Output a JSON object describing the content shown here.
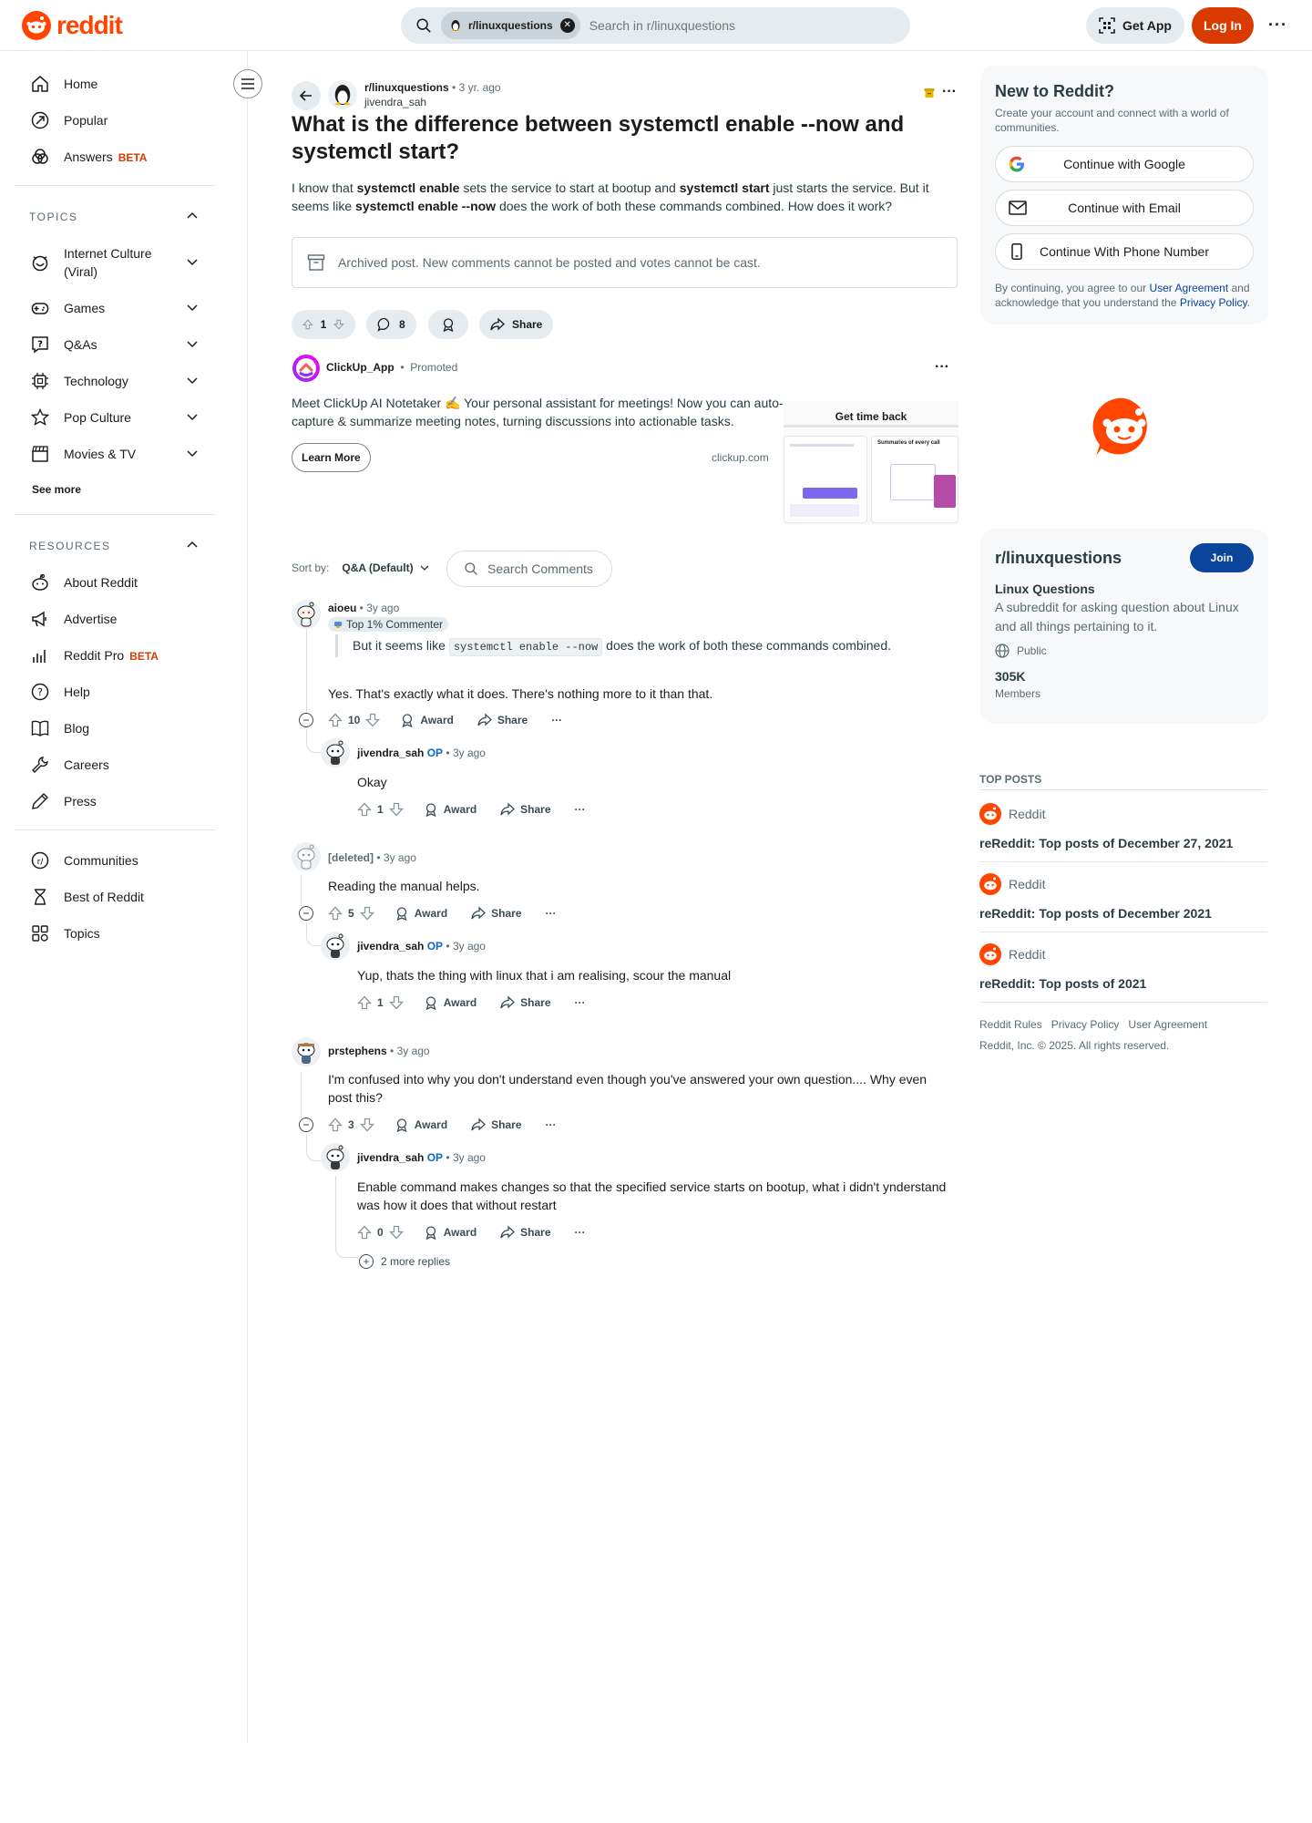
{
  "header": {
    "logo_text": "reddit",
    "search_chip": "r/linuxquestions",
    "search_placeholder": "Search in r/linuxquestions",
    "get_app": "Get App",
    "login": "Log In",
    "brand_color": "#ff4500"
  },
  "sidebar": {
    "main": [
      {
        "label": "Home",
        "icon": "home-icon"
      },
      {
        "label": "Popular",
        "icon": "popular-icon"
      },
      {
        "label": "Answers",
        "icon": "answers-icon",
        "badge": "BETA"
      }
    ],
    "topics_header": "TOPICS",
    "topics": [
      {
        "label": "Internet Culture (Viral)",
        "icon": "smiley-icon"
      },
      {
        "label": "Games",
        "icon": "gamepad-icon"
      },
      {
        "label": "Q&As",
        "icon": "question-icon"
      },
      {
        "label": "Technology",
        "icon": "chip-icon"
      },
      {
        "label": "Pop Culture",
        "icon": "star-icon"
      },
      {
        "label": "Movies & TV",
        "icon": "clapper-icon"
      }
    ],
    "see_more": "See more",
    "resources_header": "RESOURCES",
    "resources": [
      {
        "label": "About Reddit",
        "icon": "reddit-icon"
      },
      {
        "label": "Advertise",
        "icon": "megaphone-icon"
      },
      {
        "label": "Reddit Pro",
        "icon": "chart-icon",
        "badge": "BETA"
      },
      {
        "label": "Help",
        "icon": "help-icon"
      },
      {
        "label": "Blog",
        "icon": "book-icon"
      },
      {
        "label": "Careers",
        "icon": "wrench-icon"
      },
      {
        "label": "Press",
        "icon": "pen-icon"
      }
    ],
    "bottom": [
      {
        "label": "Communities",
        "icon": "communities-icon"
      },
      {
        "label": "Best of Reddit",
        "icon": "hourglass-icon"
      },
      {
        "label": "Topics",
        "icon": "topics-icon"
      }
    ]
  },
  "post": {
    "subreddit": "r/linuxquestions",
    "age": "3 yr. ago",
    "author": "jivendra_sah",
    "title": "What is the difference between systemctl enable --now and systemctl start?",
    "body_parts": [
      {
        "t": "I know that ",
        "b": false
      },
      {
        "t": "systemctl enable",
        "b": true
      },
      {
        "t": " sets the service to start at bootup and ",
        "b": false
      },
      {
        "t": "systemctl start",
        "b": true
      },
      {
        "t": " just starts the service. But it seems like ",
        "b": false
      },
      {
        "t": "systemctl enable --now",
        "b": true
      },
      {
        "t": " does the work of both these commands combined. How does it work?",
        "b": false
      }
    ],
    "archived_notice": "Archived post. New comments cannot be posted and votes cannot be cast.",
    "votes": "1",
    "comments": "8",
    "share": "Share"
  },
  "ad": {
    "advertiser": "ClickUp_App",
    "promoted": "Promoted",
    "body": "Meet ClickUp AI Notetaker ✍️ Your personal assistant for meetings! Now you can auto-capture & summarize meeting notes, turning discussions into actionable tasks.",
    "cta": "Learn More",
    "domain": "clickup.com",
    "image_title": "Get time back",
    "image_caption": "Summaries of every call"
  },
  "comments_bar": {
    "sort_label": "Sort by:",
    "sort_value": "Q&A (Default)",
    "search": "Search Comments"
  },
  "comments": [
    {
      "author": "aioeu",
      "age": "3y ago",
      "badge": "Top 1% Commenter",
      "quote_pre": "But it seems like ",
      "quote_code": "systemctl enable --now",
      "quote_post": " does the work of both these commands combined.",
      "text": "Yes. That's exactly what it does. There's nothing more to it than that.",
      "votes": "10",
      "reply": {
        "author": "jivendra_sah",
        "op": "OP",
        "age": "3y ago",
        "text": "Okay",
        "votes": "1"
      }
    },
    {
      "author": "[deleted]",
      "age": "3y ago",
      "text": "Reading the manual helps.",
      "votes": "5",
      "reply": {
        "author": "jivendra_sah",
        "op": "OP",
        "age": "3y ago",
        "text": "Yup, thats the thing with linux that i am realising, scour the manual",
        "votes": "1"
      }
    },
    {
      "author": "prstephens",
      "age": "3y ago",
      "text": "I'm confused into why you don't understand even though you've answered your own question.... Why even post this?",
      "votes": "3",
      "reply": {
        "author": "jivendra_sah",
        "op": "OP",
        "age": "3y ago",
        "text": "Enable command makes changes so that the specified service starts on bootup, what i didn't ynderstand was how it does that without restart",
        "votes": "0"
      },
      "more_replies": "2 more replies"
    }
  ],
  "actions": {
    "award": "Award",
    "share": "Share"
  },
  "right": {
    "new_title": "New to Reddit?",
    "new_desc": "Create your account and connect with a world of communities.",
    "google": "Continue with Google",
    "email": "Continue with Email",
    "phone": "Continue With Phone Number",
    "terms_pre": "By continuing, you agree to our ",
    "terms_link1": "User Agreement",
    "terms_mid": " and acknowledge that you understand the ",
    "terms_link2": "Privacy Policy",
    "terms_end": ".",
    "sub_name": "r/linuxquestions",
    "join": "Join",
    "sub_title": "Linux Questions",
    "sub_desc": "A subreddit for asking question about Linux and all things pertaining to it.",
    "public": "Public",
    "members_count": "305K",
    "members_label": "Members",
    "top_posts_header": "TOP POSTS",
    "top_posts": [
      {
        "source": "Reddit",
        "title": "reReddit: Top posts of December 27, 2021"
      },
      {
        "source": "Reddit",
        "title": "reReddit: Top posts of December 2021"
      },
      {
        "source": "Reddit",
        "title": "reReddit: Top posts of 2021"
      }
    ],
    "footer_links": [
      "Reddit Rules",
      "Privacy Policy",
      "User Agreement"
    ],
    "copyright": "Reddit, Inc. © 2025. All rights reserved."
  }
}
